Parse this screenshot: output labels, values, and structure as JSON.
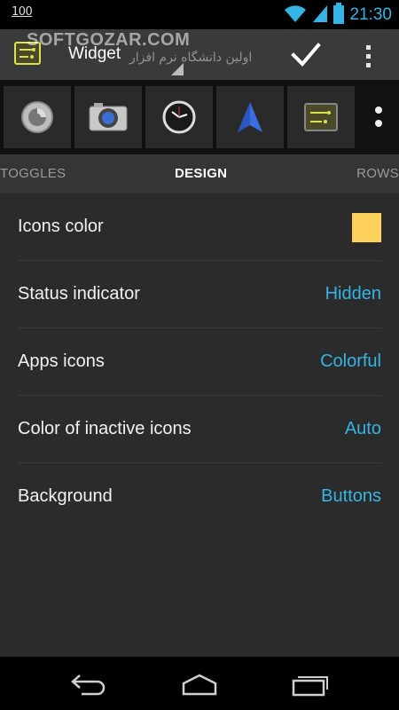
{
  "status_bar": {
    "notification_text": "100",
    "time": "21:30",
    "icons": [
      "wifi-icon",
      "signal-icon",
      "battery-icon"
    ]
  },
  "action_bar": {
    "title": "Widget",
    "watermark": "SOFTGOZAR.COM",
    "watermark_sub": "اولین دانشگاه نرم افزار",
    "icons": [
      "widget-app-icon",
      "check-icon",
      "overflow-menu-icon"
    ]
  },
  "icon_strip": {
    "items": [
      {
        "name": "settings-app-icon"
      },
      {
        "name": "camera-app-icon"
      },
      {
        "name": "clock-app-icon"
      },
      {
        "name": "navigation-app-icon"
      },
      {
        "name": "widget-app-icon"
      }
    ]
  },
  "tabs": {
    "toggles": "TOGGLES",
    "design": "DESIGN",
    "rows": "ROWS",
    "selected": "DESIGN"
  },
  "settings": {
    "icons_color": {
      "label": "Icons color",
      "swatch_color": "#FDD15C"
    },
    "status_indicator": {
      "label": "Status indicator",
      "value": "Hidden"
    },
    "apps_icons": {
      "label": "Apps icons",
      "value": "Colorful"
    },
    "inactive_icons": {
      "label": "Color of inactive icons",
      "value": "Auto"
    },
    "background": {
      "label": "Background",
      "value": "Buttons"
    }
  },
  "colors": {
    "accent": "#35B5E5",
    "background": "#2B2B2B",
    "action_bar": "#3A3A3A"
  },
  "nav_bar": {
    "icons": [
      "back-icon",
      "home-icon",
      "recents-icon"
    ]
  }
}
